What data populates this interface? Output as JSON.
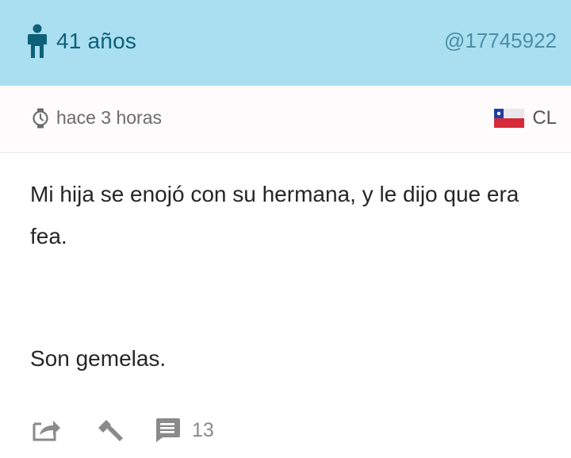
{
  "header": {
    "age_label": "41 años",
    "user_id": "@17745922",
    "icons": {
      "person": "person-icon"
    },
    "colors": {
      "background": "#a9dff1",
      "accent": "#0e5f78"
    }
  },
  "meta": {
    "time_label": "hace 3 horas",
    "country_code": "CL",
    "icons": {
      "clock": "clock-icon",
      "flag": "chile-flag-icon"
    }
  },
  "post": {
    "body": "Mi hija se enojó con su hermana, y le dijo que era fea.",
    "punchline": "Son gemelas."
  },
  "actions": {
    "icons": [
      "share-icon",
      "hammer-icon",
      "comment-icon"
    ],
    "comment_count": "13"
  }
}
